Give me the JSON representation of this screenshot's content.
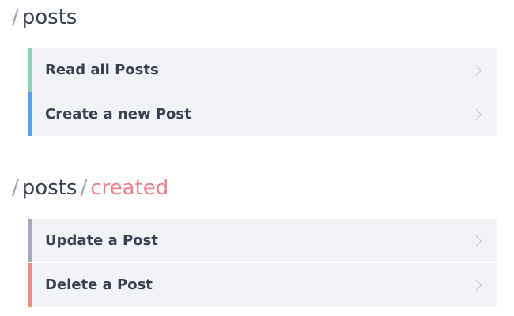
{
  "sections": [
    {
      "path": {
        "slash": "/",
        "segment": "posts"
      },
      "endpoints": [
        {
          "label": "Read all Posts",
          "color": "#8fd1b4"
        },
        {
          "label": "Create a new Post",
          "color": "#5aa0f0"
        }
      ]
    },
    {
      "path": {
        "slash": "/",
        "segment": "posts",
        "slash2": "/",
        "param": "created"
      },
      "param_color": "#f27f8a",
      "endpoints": [
        {
          "label": "Update a Post",
          "color": "#a6a9b8"
        },
        {
          "label": "Delete a Post",
          "color": "#f28a84"
        }
      ]
    }
  ],
  "icons": {
    "row_chevron": "chevron-right-icon"
  }
}
